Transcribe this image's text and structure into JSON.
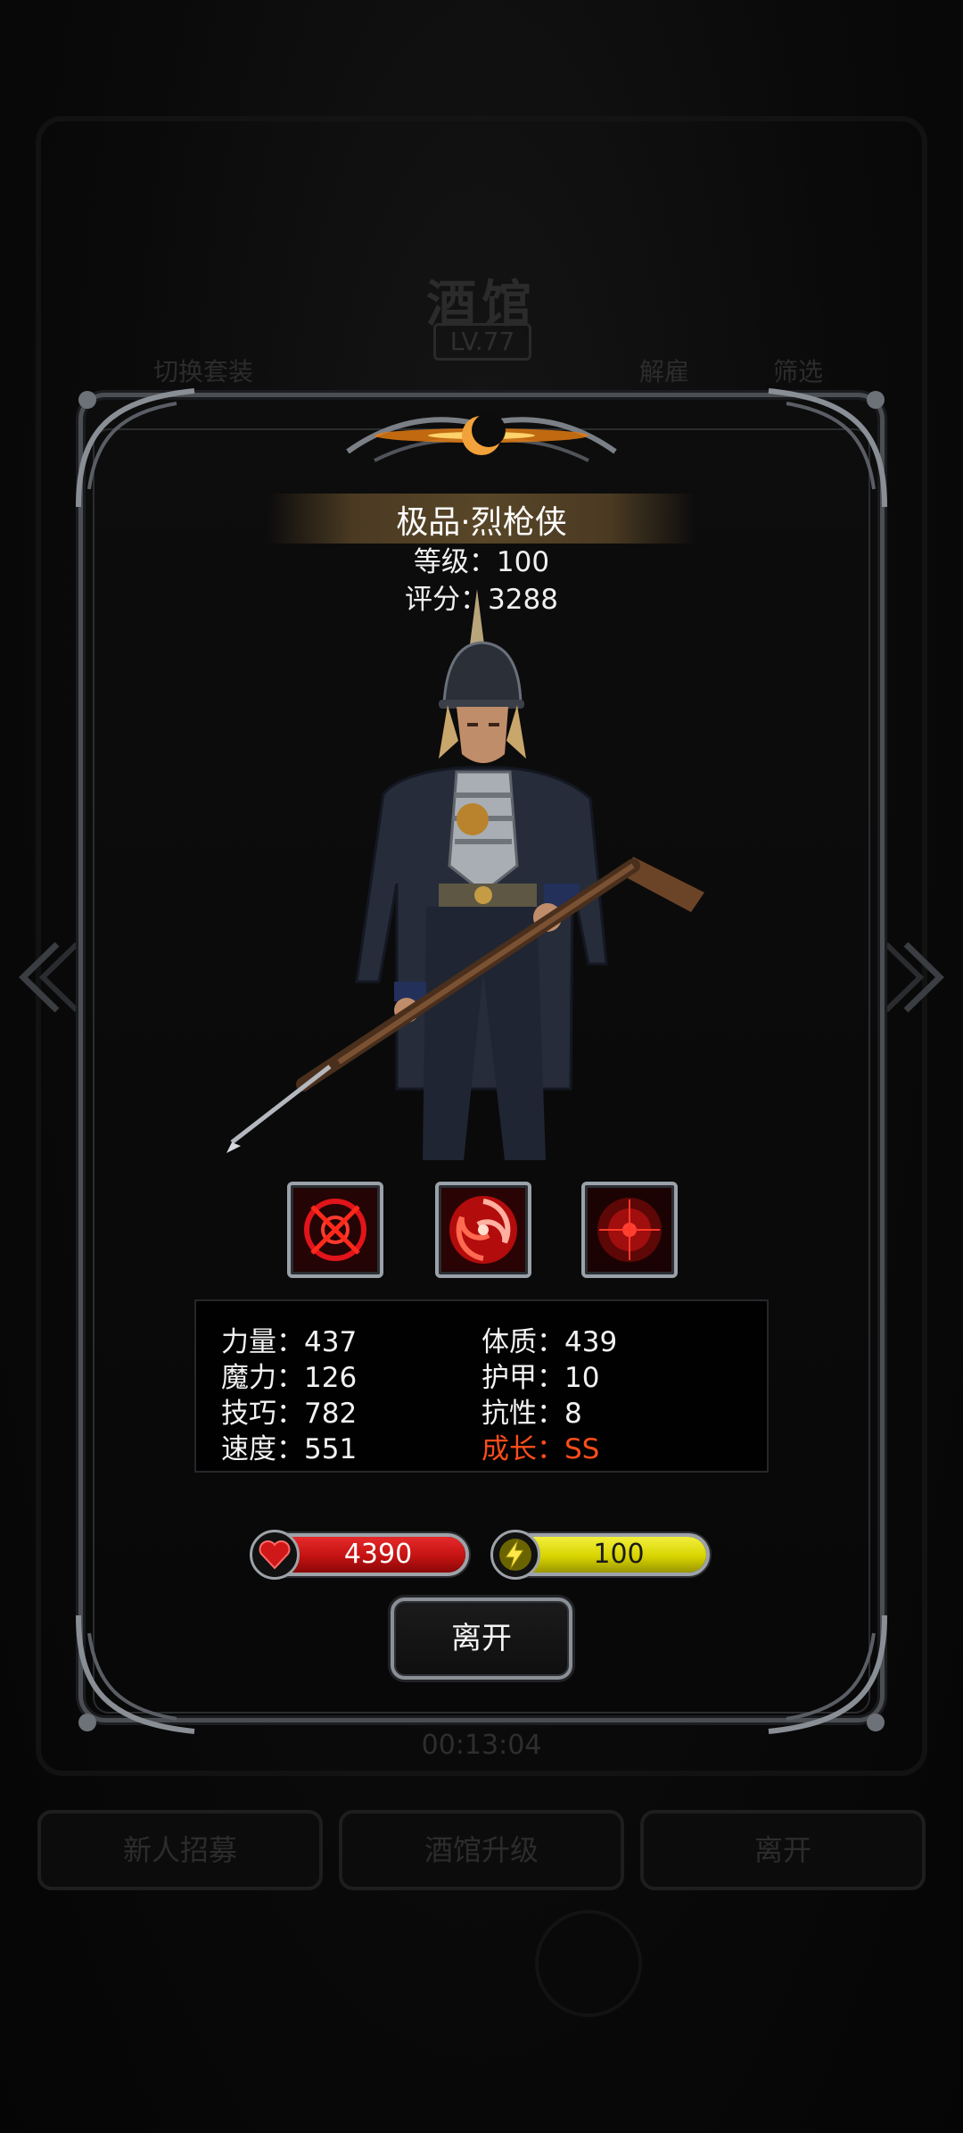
{
  "background": {
    "title": "酒馆",
    "level_badge": "LV.77",
    "tabs": [
      "切换套装",
      "解雇",
      "筛选"
    ],
    "timer": "00:13:04",
    "buttons": [
      "新人招募",
      "酒馆升级",
      "离开"
    ]
  },
  "hero": {
    "name": "极品·烈枪侠",
    "level": "等级：100",
    "score": "评分：3288",
    "skills": [
      {
        "icon": "crosshair-skill-icon"
      },
      {
        "icon": "vortex-skill-icon"
      },
      {
        "icon": "target-skill-icon"
      }
    ],
    "stats_left": [
      "力量：437",
      "魔力：126",
      "技巧：782",
      "速度：551"
    ],
    "stats_right": [
      "体质：439",
      "护甲：10",
      "抗性：8",
      "成长：SS"
    ],
    "hp": "4390",
    "energy": "100",
    "leave_label": "离开"
  },
  "colors": {
    "accent_growth": "#ff4d1a",
    "hp_bar": "#c41212",
    "energy_bar": "#d8d400",
    "frame": "#4b4f54"
  }
}
